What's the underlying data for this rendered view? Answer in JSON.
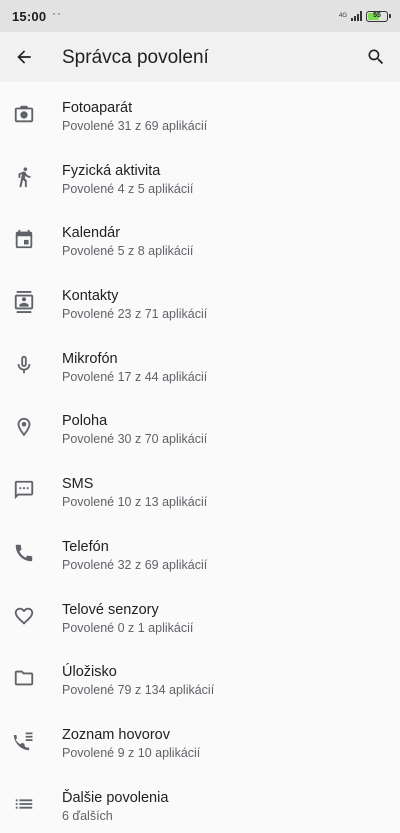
{
  "status_bar": {
    "time": "15:00",
    "notification_dots": "··",
    "network": "4G",
    "battery_level": "55"
  },
  "header": {
    "title": "Správca povolení",
    "back_icon": "arrow-back-icon",
    "search_icon": "search-icon"
  },
  "permissions": [
    {
      "icon": "camera-icon",
      "title": "Fotoaparát",
      "subtitle": "Povolené 31 z 69 aplikácií"
    },
    {
      "icon": "walking-person-icon",
      "title": "Fyzická aktivita",
      "subtitle": "Povolené 4 z 5 aplikácií"
    },
    {
      "icon": "calendar-icon",
      "title": "Kalendár",
      "subtitle": "Povolené 5 z 8 aplikácií"
    },
    {
      "icon": "contacts-icon",
      "title": "Kontakty",
      "subtitle": "Povolené 23 z 71 aplikácií"
    },
    {
      "icon": "microphone-icon",
      "title": "Mikrofón",
      "subtitle": "Povolené 17 z 44 aplikácií"
    },
    {
      "icon": "location-pin-icon",
      "title": "Poloha",
      "subtitle": "Povolené 30 z 70 aplikácií"
    },
    {
      "icon": "sms-icon",
      "title": "SMS",
      "subtitle": "Povolené 10 z 13 aplikácií"
    },
    {
      "icon": "phone-icon",
      "title": "Telefón",
      "subtitle": "Povolené 32 z 69 aplikácií"
    },
    {
      "icon": "heart-icon",
      "title": "Telové senzory",
      "subtitle": "Povolené 0 z 1 aplikácií"
    },
    {
      "icon": "folder-icon",
      "title": "Úložisko",
      "subtitle": "Povolené 79 z 134 aplikácií"
    },
    {
      "icon": "call-log-icon",
      "title": "Zoznam hovorov",
      "subtitle": "Povolené 9 z 10 aplikácií"
    },
    {
      "icon": "list-icon",
      "title": "Ďalšie povolenia",
      "subtitle": "6 ďalších"
    }
  ]
}
